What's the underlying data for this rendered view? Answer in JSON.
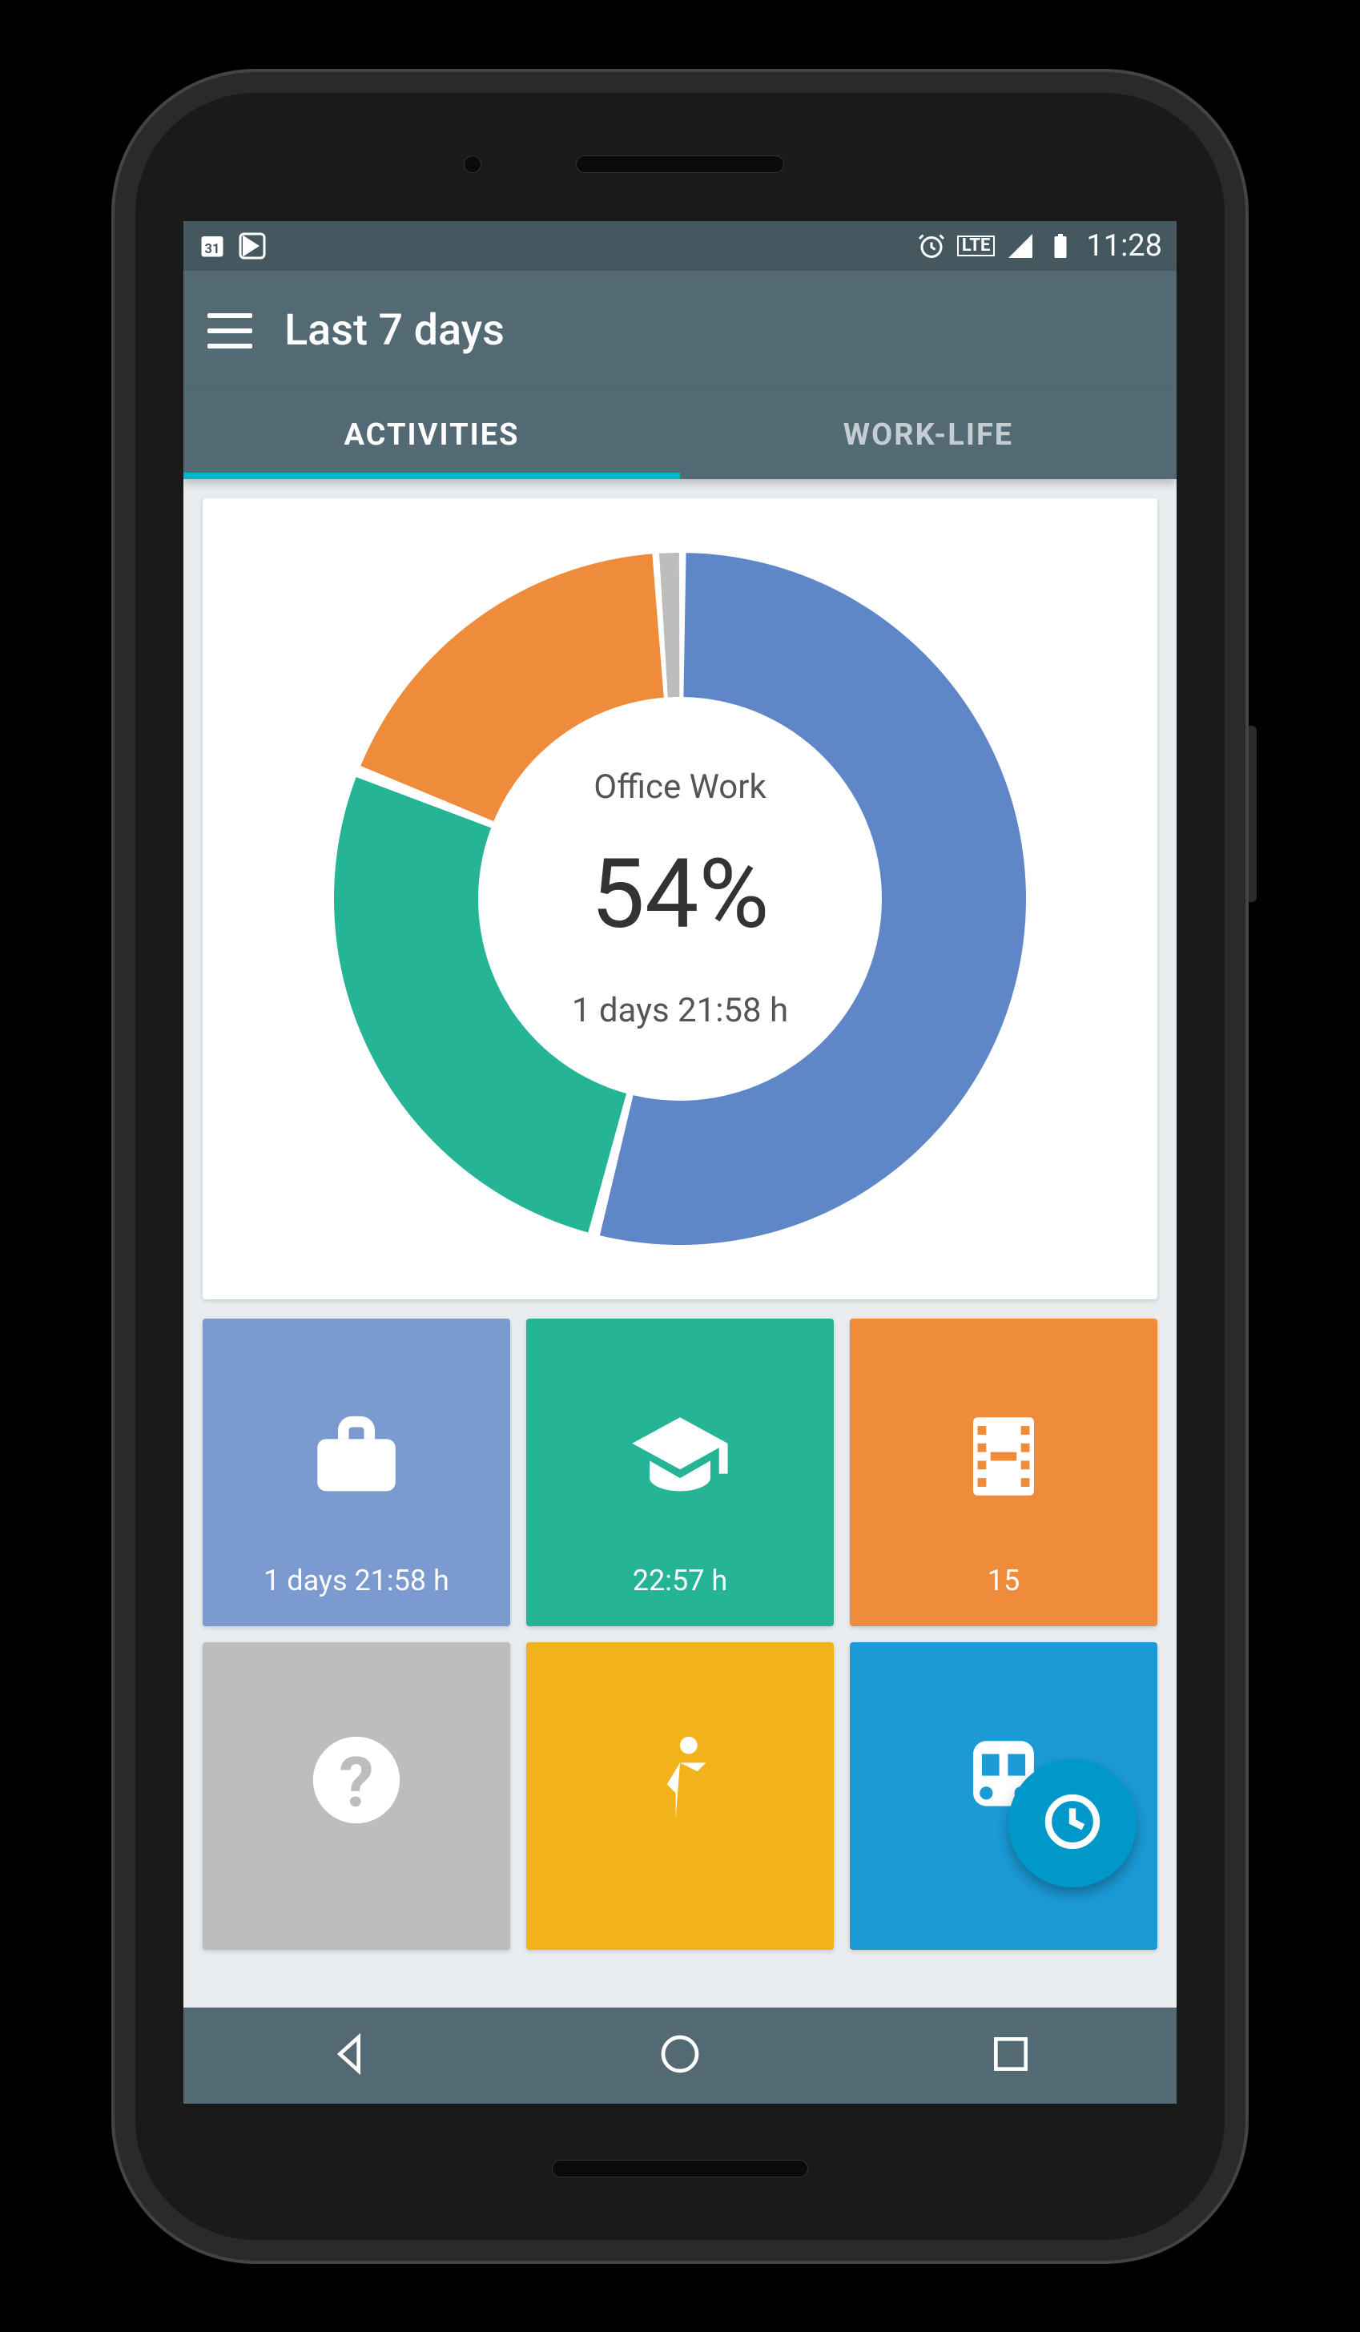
{
  "status_bar": {
    "left_icons": [
      "calendar-31-icon",
      "play-store-icon"
    ],
    "right_icons": [
      "alarm-icon",
      "lte-icon",
      "signal-icon",
      "battery-icon"
    ],
    "lte_text": "LTE",
    "time": "11:28"
  },
  "app_bar": {
    "title": "Last 7 days"
  },
  "tabs": [
    {
      "label": "ACTIVITIES",
      "active": true
    },
    {
      "label": "WORK-LIFE",
      "active": false
    }
  ],
  "chart_data": {
    "type": "pie",
    "title": "",
    "center_label": "Office Work",
    "center_percent": "54%",
    "center_duration": "1 days 21:58 h",
    "series": [
      {
        "name": "Office Work",
        "value": 54,
        "color": "#5f87c7"
      },
      {
        "name": "Study",
        "value": 27,
        "color": "#26b496"
      },
      {
        "name": "Entertainment",
        "value": 18,
        "color": "#ee8c3b"
      },
      {
        "name": "Other",
        "value": 1,
        "color": "#bdbdbd"
      }
    ]
  },
  "tiles": [
    {
      "icon": "briefcase-icon",
      "color": "#7a9ad0",
      "duration": "1 days 21:58 h"
    },
    {
      "icon": "graduation-cap-icon",
      "color": "#26b496",
      "duration": "22:57 h"
    },
    {
      "icon": "film-icon",
      "color": "#ee8c3b",
      "duration": "15"
    },
    {
      "icon": "question-icon",
      "color": "#bdbdbd",
      "duration": ""
    },
    {
      "icon": "running-icon",
      "color": "#f2b21b",
      "duration": ""
    },
    {
      "icon": "train-icon",
      "color": "#1b9ad6",
      "duration": ""
    }
  ],
  "fab": {
    "icon": "clock-icon"
  },
  "nav_bar": {
    "buttons": [
      "back-icon",
      "home-icon",
      "recent-icon"
    ]
  },
  "colors": {
    "status_bg": "#455860",
    "appbar_bg": "#536a74",
    "accent": "#00b6c7",
    "fab": "#0097c9",
    "content_bg": "#e9edef"
  }
}
